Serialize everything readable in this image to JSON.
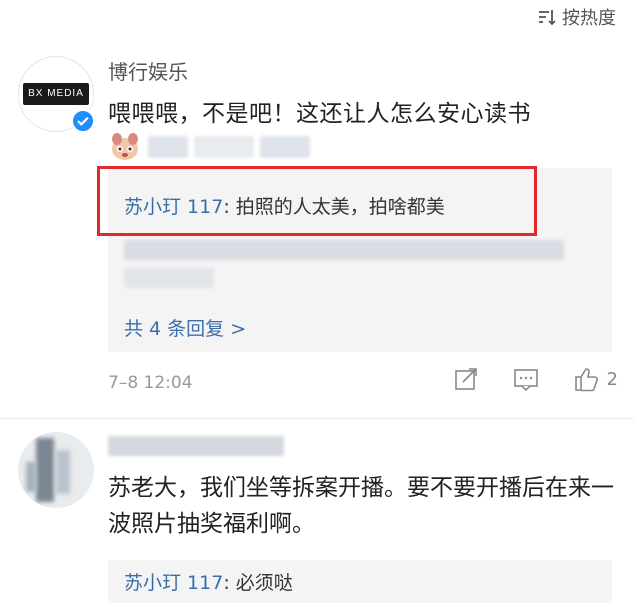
{
  "sort": {
    "label": "按热度"
  },
  "comment1": {
    "avatar_text": "BX MEDIA",
    "username": "博行娱乐",
    "text": "喂喂喂，不是吧！这还让人怎么安心读书",
    "replies": [
      {
        "user": "苏小玎 117",
        "sep": ": ",
        "text": "拍照的人太美，拍啥都美"
      }
    ],
    "more_replies": "共 4 条回复 >",
    "timestamp": "7–8 12:04",
    "likes": "2"
  },
  "comment2": {
    "text": "苏老大，我们坐等拆案开播。要不要开播后在来一波照片抽奖福利啊。",
    "replies": [
      {
        "user": "苏小玎 117",
        "sep": ": ",
        "text": "必须哒"
      }
    ]
  },
  "colors": {
    "link": "#3b6ea8",
    "highlight": "#e0292d",
    "verified": "#1f8fff"
  }
}
